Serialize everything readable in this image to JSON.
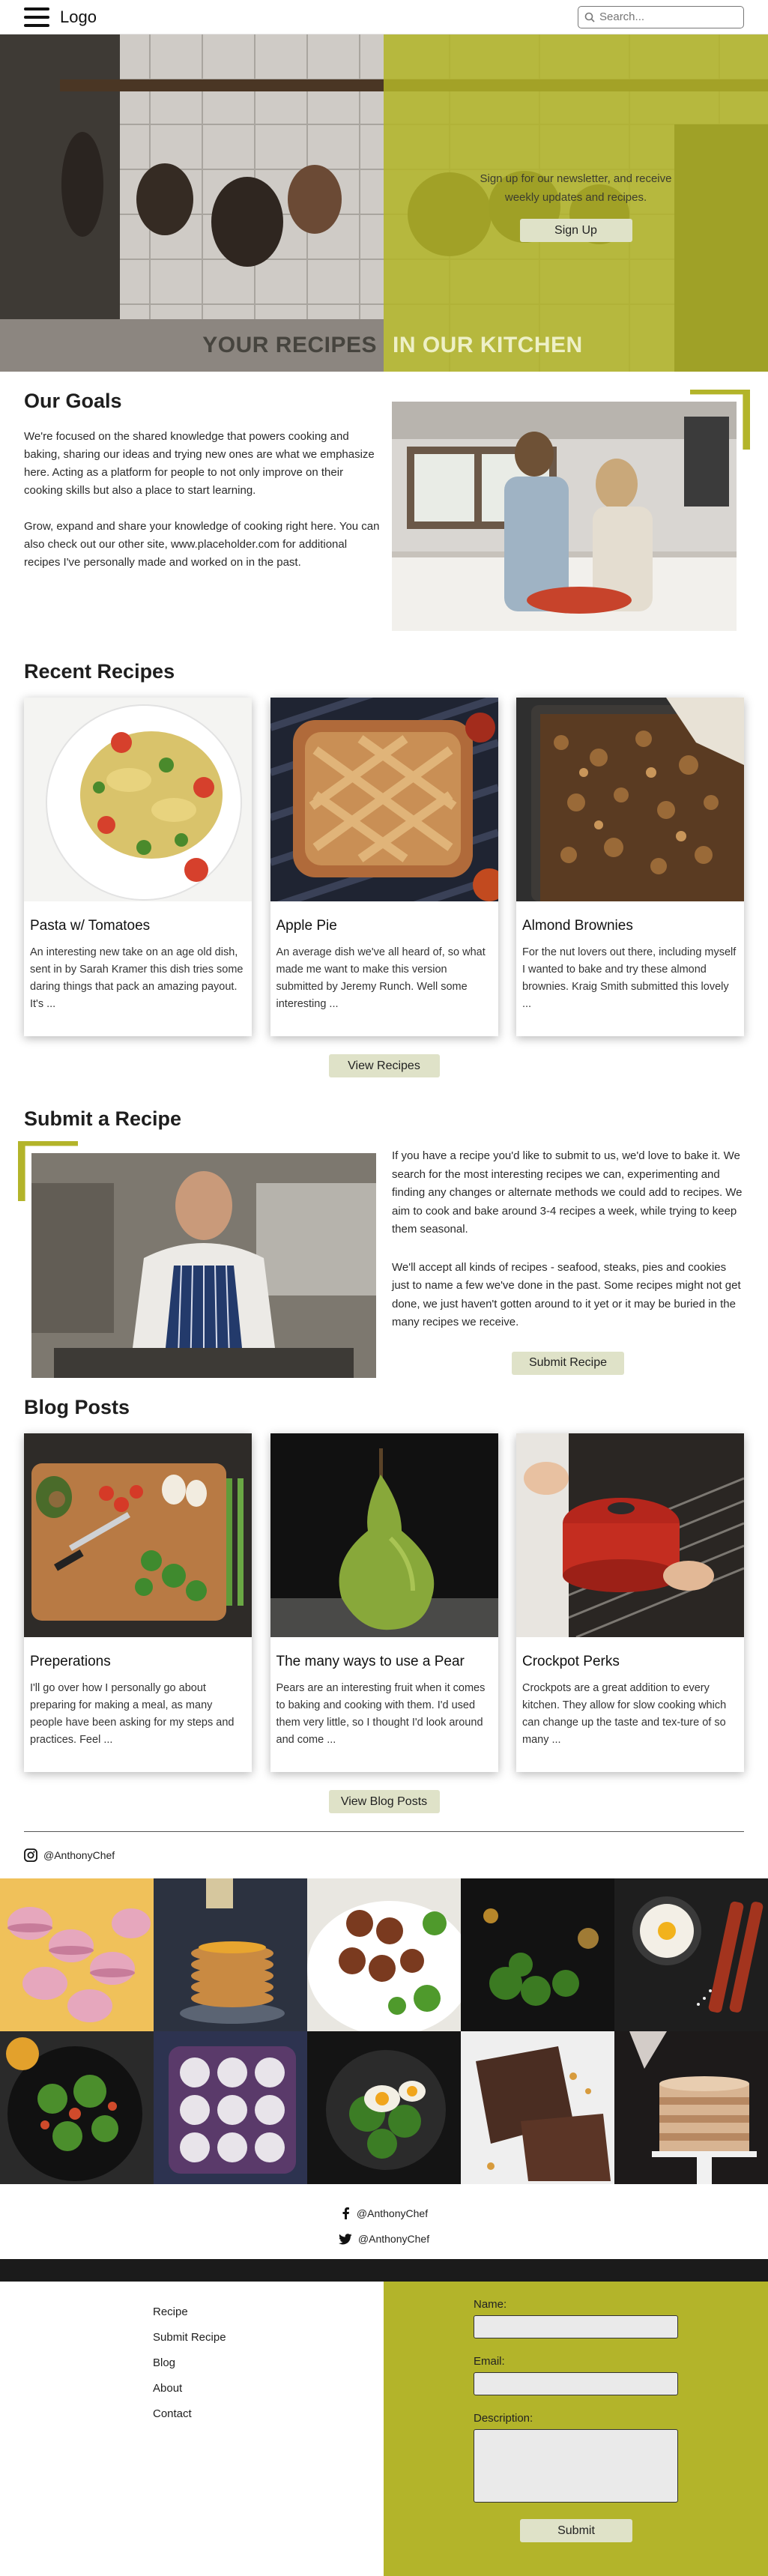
{
  "header": {
    "logo": "Logo",
    "search_placeholder": "Search...",
    "icons": [
      "menu-icon",
      "search-icon"
    ]
  },
  "hero": {
    "newsletter_line1": "Sign up for our newsletter, and receive",
    "newsletter_line2": "weekly updates and recipes.",
    "signup_label": "Sign Up",
    "title_left": "YOUR RECIPES",
    "title_right": "IN OUR KITCHEN"
  },
  "goals": {
    "title": "Our Goals",
    "p1": "We're focused on the shared knowledge that powers cooking and baking, sharing our ideas and trying new ones are what we emphasize here. Acting as a platform for people to not only improve on their cooking skills but also a place to start learning.",
    "p2": "Grow, expand and share your knowledge of cooking right here. You can also check out our other site, www.placeholder.com for additional recipes I've personally made and worked on in the past."
  },
  "recipes": {
    "title": "Recent Recipes",
    "items": [
      {
        "title": "Pasta w/ Tomatoes",
        "text": "An interesting new take on an age old dish, sent in by Sarah Kramer this dish tries some daring things that pack an amazing payout. It's ..."
      },
      {
        "title": "Apple Pie",
        "text": "An average dish we've all heard of, so what made me want to make this version submitted by Jeremy Runch. Well some interesting ..."
      },
      {
        "title": "Almond Brownies",
        "text": "For the nut lovers out there, including myself I wanted to bake and try these almond brownies. Kraig Smith submitted this lovely ..."
      }
    ],
    "button": "View Recipes"
  },
  "submit": {
    "title": "Submit a Recipe",
    "p1": "If you have a recipe you'd like to submit to us, we'd love to bake it. We search for the most interesting recipes we can, experimenting and finding any changes or alternate methods we could add to recipes. We aim to cook and bake around 3-4 recipes a week, while trying to keep them seasonal.",
    "p2": "We'll accept all kinds of recipes - seafood, steaks, pies and cookies just to name a few we've done in the past. Some recipes might not get done, we just haven't gotten around to it yet or it may be buried in the many recipes we receive.",
    "button": "Submit Recipe"
  },
  "blog": {
    "title": "Blog Posts",
    "items": [
      {
        "title": "Preperations",
        "text": "I'll go over how I personally go about preparing for making a meal, as many people have been asking for my steps and practices. Feel ..."
      },
      {
        "title": "The many ways to use a Pear",
        "text": "Pears are an interesting fruit when it comes to baking and cooking with them. I'd used them very little, so I thought I'd look around and come ..."
      },
      {
        "title": "Crockpot Perks",
        "text": "Crockpots are a great addition to every kitchen. They allow for slow cooking which can change up the taste and tex-ture of so many ..."
      }
    ],
    "button": "View Blog Posts"
  },
  "social": {
    "instagram": "@AnthonyChef",
    "facebook": "@AnthonyChef",
    "twitter": "@AnthonyChef"
  },
  "footer": {
    "links": [
      "Recipe",
      "Submit Recipe",
      "Blog",
      "About",
      "Contact"
    ],
    "form": {
      "name_label": "Name:",
      "email_label": "Email:",
      "description_label": "Description:",
      "submit_label": "Submit"
    }
  },
  "colors": {
    "accent": "#b3b42a",
    "button": "#dfe2c8",
    "dark_band": "#1b1b1b"
  }
}
